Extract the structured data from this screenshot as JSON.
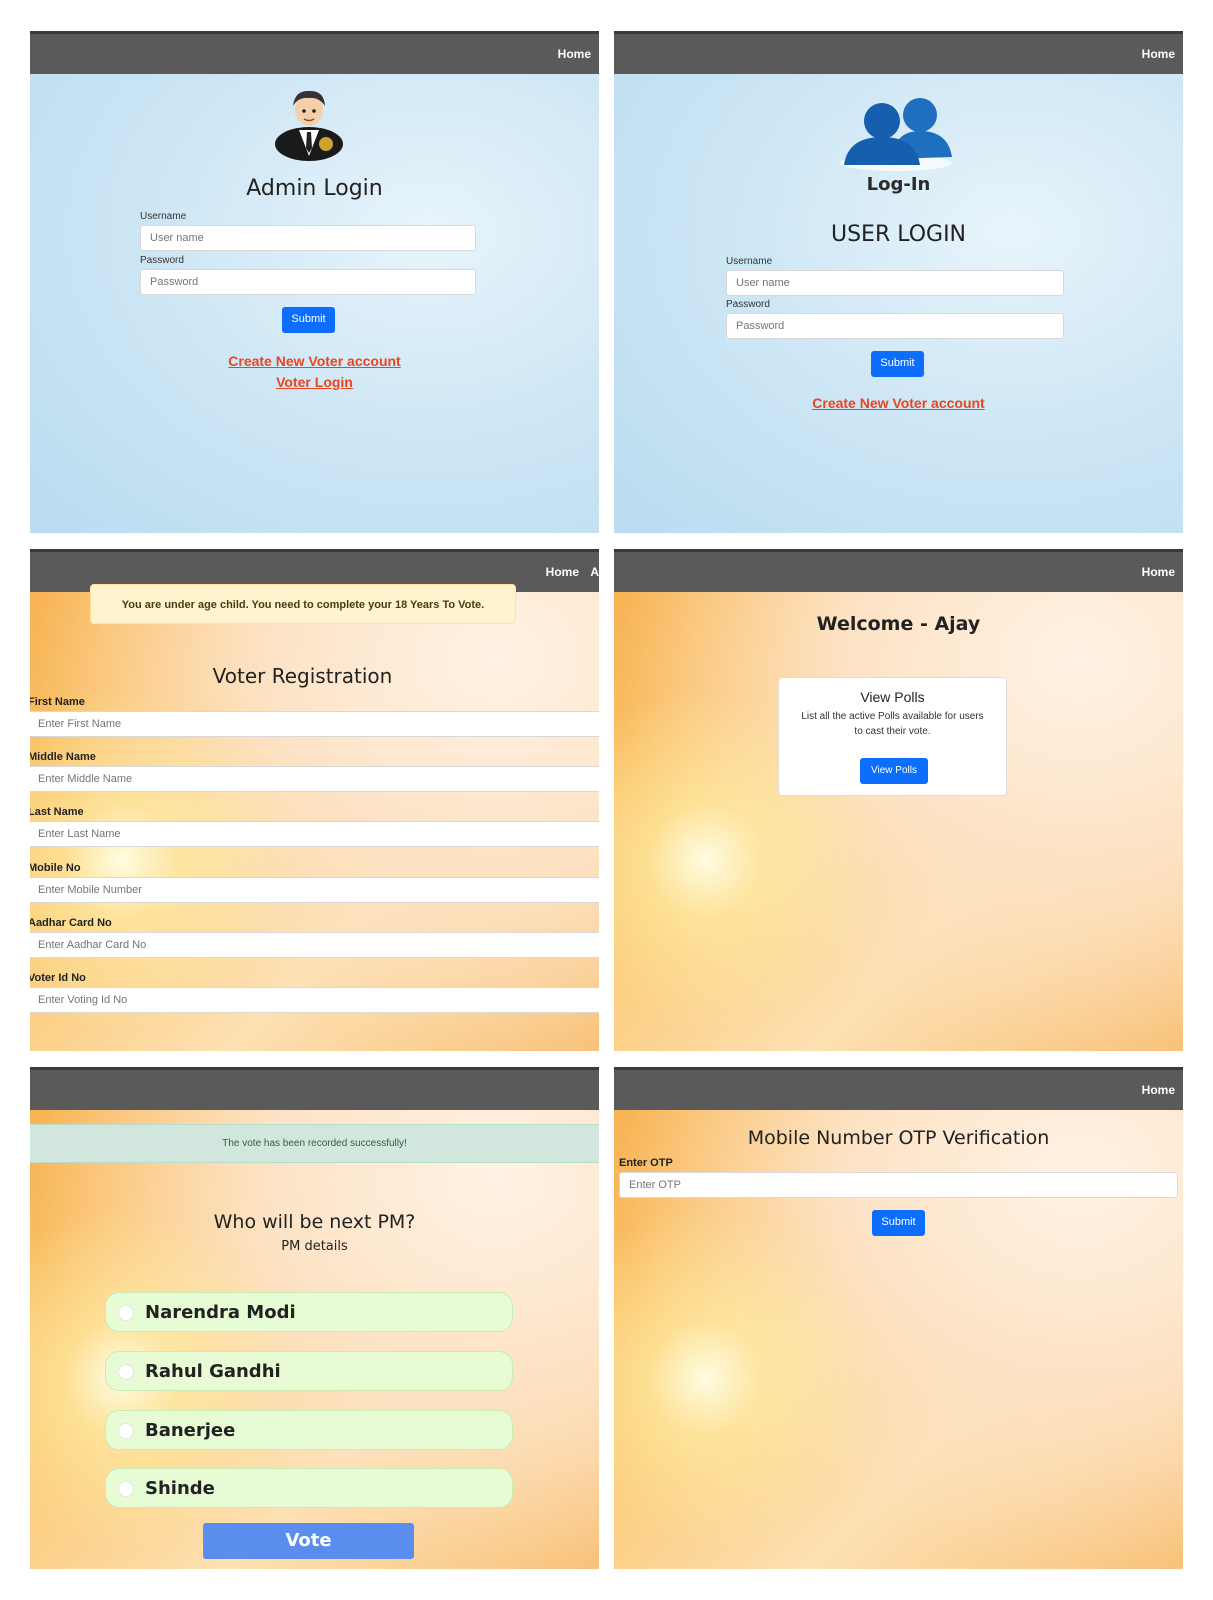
{
  "admin_login": {
    "nav_home": "Home",
    "title": "Admin Login",
    "username_label": "Username",
    "username_placeholder": "User name",
    "password_label": "Password",
    "password_placeholder": "Password",
    "submit": "Submit",
    "create_account_link": "Create New Voter account",
    "voter_login_link": "Voter Login",
    "avatar_icon": "admin-avatar-icon"
  },
  "user_login": {
    "nav_home": "Home",
    "logo_text": "Log-In",
    "title": "USER LOGIN",
    "username_label": "Username",
    "username_placeholder": "User name",
    "password_label": "Password",
    "password_placeholder": "Password",
    "submit": "Submit",
    "create_account_link": "Create New Voter account",
    "logo_icon": "users-icon"
  },
  "voter_registration": {
    "nav_home": "Home",
    "nav_next_clipped": "A",
    "alert": "You are under age child. You need to complete your 18 Years To Vote.",
    "title": "Voter Registration",
    "fields": [
      {
        "label": "First Name",
        "placeholder": "Enter First Name"
      },
      {
        "label": "Middle Name",
        "placeholder": "Enter Middle Name"
      },
      {
        "label": "Last Name",
        "placeholder": "Enter Last Name"
      },
      {
        "label": "Mobile No",
        "placeholder": "Enter Mobile Number"
      },
      {
        "label": "Aadhar Card No",
        "placeholder": "Enter Aadhar Card No"
      },
      {
        "label": "Voter Id No",
        "placeholder": "Enter Voting Id No"
      }
    ]
  },
  "welcome": {
    "nav_home": "Home",
    "title": "Welcome - Ajay",
    "card_title": "View Polls",
    "card_text_line1": "List all the active Polls available for users",
    "card_text_line2": "to cast their vote.",
    "card_button": "View Polls"
  },
  "poll": {
    "success_alert": "The vote has been recorded successfully!",
    "question": "Who will be next PM?",
    "subtitle": "PM details",
    "options": [
      "Narendra Modi",
      "Rahul Gandhi",
      "Banerjee",
      "Shinde"
    ],
    "vote_button": "Vote"
  },
  "otp": {
    "nav_home": "Home",
    "title": "Mobile Number OTP Verification",
    "otp_label": "Enter OTP",
    "otp_placeholder": "Enter OTP",
    "submit": "Submit"
  },
  "colors": {
    "navbar": "#5a5a5a",
    "primary_button": "#0d6efd",
    "link": "#e8461e",
    "option_bg": "#e7fbd4",
    "success_alert_bg": "#d1e7dd",
    "warning_alert_bg": "#fff3cd"
  }
}
